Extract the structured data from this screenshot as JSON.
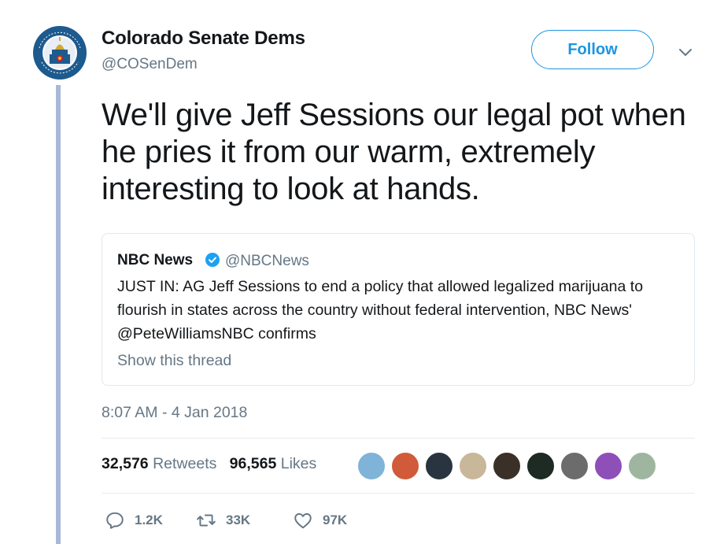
{
  "tweet": {
    "display_name": "Colorado Senate Dems",
    "handle": "@COSenDem",
    "avatar_ring_text": "COLORADO SENATE DEMOCRATS",
    "follow_label": "Follow",
    "caret_icon": "chevron-down-icon",
    "text": "We'll give Jeff Sessions our legal pot when he pries it from our warm, extremely interesting to look at hands.",
    "timestamp": "8:07 AM - 4 Jan 2018"
  },
  "quoted": {
    "name": "NBC News",
    "verified_icon": "verified-badge-icon",
    "handle": "@NBCNews",
    "text": "JUST IN: AG Jeff Sessions to end a policy that allowed legalized marijuana to flourish in states across the country without federal intervention, NBC News' @PeteWilliamsNBC confirms",
    "show_thread": "Show this thread"
  },
  "stats": {
    "retweets_count": "32,576",
    "retweets_label": "Retweets",
    "likes_count": "96,565",
    "likes_label": "Likes"
  },
  "actions": {
    "reply": "1.2K",
    "retweet": "33K",
    "like": "97K"
  },
  "colors": {
    "accent": "#1b95e0",
    "secondary_text": "#657786",
    "thread_line": "#a8b8d8"
  }
}
